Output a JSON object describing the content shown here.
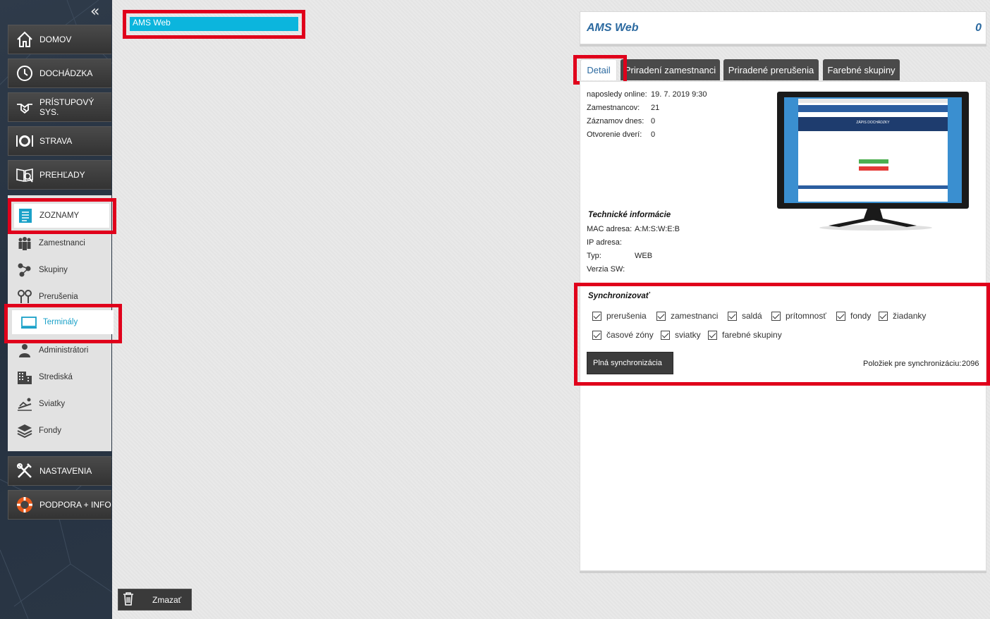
{
  "sidebar": {
    "collapse_icon": "double-chevron-left-icon",
    "main_items": [
      {
        "label": "DOMOV",
        "icon": "home-icon"
      },
      {
        "label": "DOCHÁDZKA",
        "icon": "clock-icon"
      },
      {
        "label": "PRÍSTUPOVÝ SYS.",
        "icon": "handshake-icon"
      },
      {
        "label": "STRAVA",
        "icon": "plate-icon"
      },
      {
        "label": "PREHĽADY",
        "icon": "book-search-icon"
      },
      {
        "label": "NASTAVENIA",
        "icon": "tools-icon"
      },
      {
        "label": "PODPORA + INFO",
        "icon": "lifebuoy-icon"
      }
    ],
    "zoznamy": {
      "label": "ZOZNAMY",
      "icon": "list-icon"
    },
    "sub_items": [
      {
        "label": "Zamestnanci",
        "icon": "people-icon"
      },
      {
        "label": "Skupiny",
        "icon": "groups-icon"
      },
      {
        "label": "Prerušenia",
        "icon": "pin-icon"
      },
      {
        "label": "Terminály",
        "icon": "monitor-icon"
      },
      {
        "label": "Administrátori",
        "icon": "admin-icon"
      },
      {
        "label": "Strediská",
        "icon": "building-icon"
      },
      {
        "label": "Sviatky",
        "icon": "beach-icon"
      },
      {
        "label": "Fondy",
        "icon": "layers-icon"
      }
    ]
  },
  "terminal_list": {
    "items": [
      "AMS Web"
    ]
  },
  "delete_button": {
    "label": "Zmazať",
    "icon": "trash-icon"
  },
  "detail": {
    "title": "AMS Web",
    "count": "0",
    "tabs": [
      "Detail",
      "Priradení zamestnanci",
      "Priradené prerušenia",
      "Farebné skupiny"
    ],
    "info": [
      {
        "label": "naposledy online:",
        "value": "19. 7. 2019 9:30"
      },
      {
        "label": "Zamestnancov:",
        "value": "21"
      },
      {
        "label": "Záznamov dnes:",
        "value": "0"
      },
      {
        "label": "Otvorenie dverí:",
        "value": "0"
      }
    ],
    "tech_title": "Technické informácie",
    "tech": [
      {
        "label": "MAC adresa:",
        "value": "A:M:S:W:E:B"
      },
      {
        "label": "IP adresa:",
        "value": ""
      },
      {
        "label": "Typ:",
        "value": "WEB"
      },
      {
        "label": "Verzia SW:",
        "value": ""
      }
    ],
    "monitor_screen": {
      "title": "ZÁPIS DOCHÁDZKY"
    },
    "sync": {
      "title": "Synchronizovať",
      "row1": [
        "prerušenia",
        "zamestnanci",
        "saldá",
        "prítomnosť",
        "fondy",
        "žiadanky"
      ],
      "row2": [
        "časové zóny",
        "sviatky",
        "farebné skupiny"
      ],
      "full_sync_label": "Plná synchronizácia",
      "count_label": "Položiek pre synchronizáciu:",
      "count_value": "2096"
    }
  },
  "colors": {
    "accent": "#0bb5dd",
    "highlight": "#e0001b",
    "title_blue": "#2c6aa0"
  }
}
